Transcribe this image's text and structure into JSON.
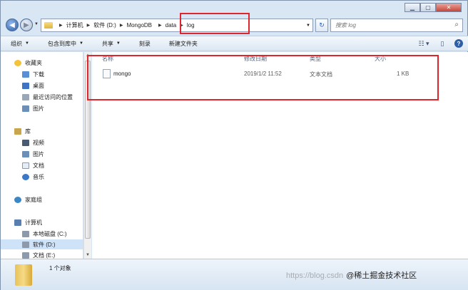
{
  "window": {
    "buttons": {
      "minimize": "▁",
      "maximize": "▢",
      "close": "✕"
    }
  },
  "address": {
    "crumbs": [
      "计算机",
      "软件 (D:)",
      "MongoDB",
      "data",
      "log"
    ],
    "search_placeholder": "搜索 log",
    "back_glyph": "◀",
    "forward_glyph": "▶",
    "refresh_glyph": "↻",
    "search_glyph": "⌕"
  },
  "toolbar": {
    "items": [
      "组织",
      "包含到库中",
      "共享",
      "刻录",
      "新建文件夹"
    ],
    "has_caret": [
      true,
      true,
      true,
      false,
      false
    ],
    "right_icons": [
      "view-options-icon",
      "preview-pane-icon",
      "help-icon"
    ]
  },
  "navpane": {
    "favorites_header": "收藏夹",
    "favorites": [
      "下载",
      "桌面",
      "最近访问的位置",
      "图片"
    ],
    "library_header": "库",
    "libraries": [
      "视频",
      "图片",
      "文档",
      "音乐"
    ],
    "homegroup": "家庭组",
    "computer_header": "计算机",
    "drives": [
      "本地磁盘 (C:)",
      "软件 (D:)",
      "文档 (E:)"
    ],
    "selected_drive": "软件 (D:)"
  },
  "content": {
    "columns": [
      "名称",
      "修改日期",
      "类型",
      "大小"
    ],
    "rows": [
      {
        "name": "mongo",
        "modified": "2019/1/2 11:52",
        "type": "文本文档",
        "size": "1 KB"
      }
    ]
  },
  "details": {
    "count": "1 个对象"
  },
  "watermark": {
    "url": "https://blog.csdn",
    "brand": "@稀土掘金技术社区"
  },
  "colors": {
    "highlight": "#e0262d",
    "selection": "#cfe3f8",
    "chrome": "#d9e6f3"
  }
}
